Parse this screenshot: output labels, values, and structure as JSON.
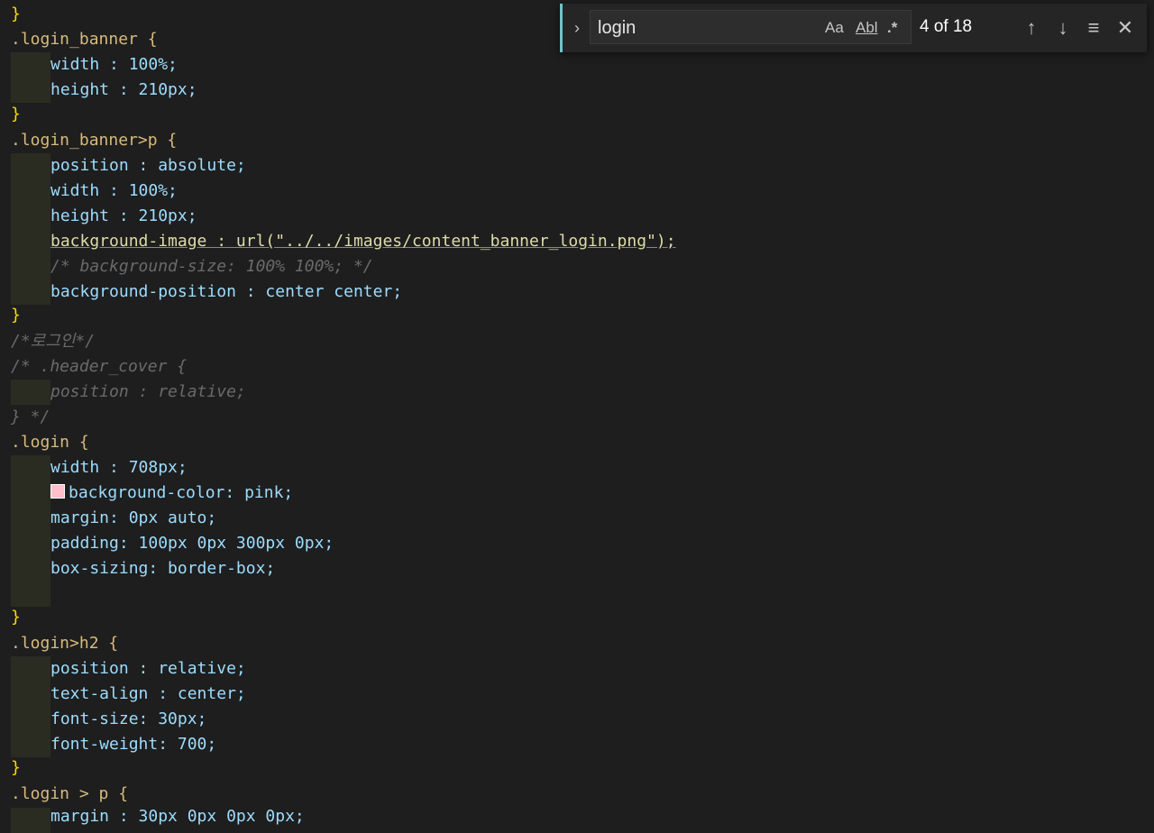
{
  "find": {
    "query": "login",
    "match_case_label": "Aa",
    "whole_word_label": "Abl",
    "regex_label": ".*",
    "match_count": "4 of 18"
  },
  "code": {
    "l1_brace": "}",
    "login_banner_selector": ".login_banner {",
    "width_100": "width : 100%;",
    "height_210": "height : 210px;",
    "close_brace": "}",
    "login_banner_p_selector": ".login_banner>p {",
    "position_absolute": "position : absolute;",
    "background_image": "background-image : url(\"../../images/content_banner_login.png\");",
    "bg_size_comment": "/* background-size: 100% 100%; */",
    "background_position": "background-position : center center;",
    "comment_login_ko": "/*로그인*/",
    "comment_header_cover": "/* .header_cover {",
    "comment_position_relative": "position : relative;",
    "comment_close": "} */",
    "login_selector": ".login {",
    "width_708": "width : 708px;",
    "background_color": "background-color: pink;",
    "margin_auto": "margin: 0px auto;",
    "padding": "padding: 100px 0px 300px 0px;",
    "box_sizing": "box-sizing: border-box;",
    "login_h2_selector": ".login>h2 {",
    "position_relative": "position : relative;",
    "text_align": "text-align : center;",
    "font_size": "font-size: 30px;",
    "font_weight": "font-weight: 700;",
    "login_p_selector": ".login > p {",
    "margin_partial": "margin : 30px 0px 0px 0px;"
  },
  "colors": {
    "background": "#1e1e1e",
    "find_accent": "#6cc5c6",
    "cursor": "#ffcc00"
  }
}
